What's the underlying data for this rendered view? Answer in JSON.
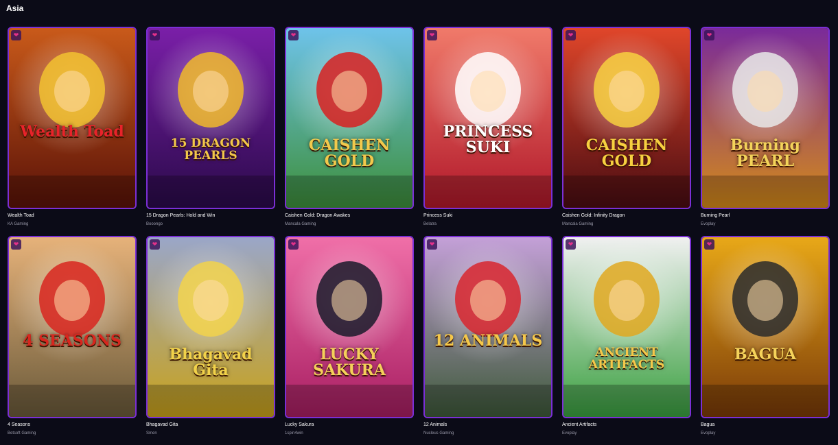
{
  "section": {
    "title": "Asia"
  },
  "games": [
    {
      "name": "Wealth Toad",
      "provider": "KA Gaming",
      "bg": [
        "#c95a1a",
        "#5a1208"
      ],
      "accent": "#f2c230",
      "logo": "Wealth Toad",
      "logo_color": "#e8232a",
      "fav_icon": "heart-icon"
    },
    {
      "name": "15 Dragon Pearls: Hold and Win",
      "provider": "Booongo",
      "bg": [
        "#7a1fa8",
        "#2a0a4a"
      ],
      "accent": "#f0b82a",
      "logo": "15 DRAGON PEARLS",
      "logo_color": "#f3c84a",
      "fav_icon": "heart-icon"
    },
    {
      "name": "Caishen Gold: Dragon Awakes",
      "provider": "Mancala Gaming",
      "bg": [
        "#6ec3ea",
        "#3d8f3a"
      ],
      "accent": "#d82020",
      "logo": "CAISHEN GOLD",
      "logo_color": "#f2c94c",
      "fav_icon": "heart-icon"
    },
    {
      "name": "Princess Suki",
      "provider": "Belatra",
      "bg": [
        "#f07a6a",
        "#b1182a"
      ],
      "accent": "#ffffff",
      "logo": "PRINCESS SUKI",
      "logo_color": "#ffffff",
      "fav_icon": "heart-icon"
    },
    {
      "name": "Caishen Gold: Infinity Dragon",
      "provider": "Mancala Gaming",
      "bg": [
        "#e0462a",
        "#4a0c12"
      ],
      "accent": "#f7d040",
      "logo": "CAISHEN GOLD",
      "logo_color": "#f7d040",
      "fav_icon": "heart-icon"
    },
    {
      "name": "Burning Pearl",
      "provider": "Evoplay",
      "bg": [
        "#7a2a9a",
        "#d48a18"
      ],
      "accent": "#e8e8e8",
      "logo": "Burning PEARL",
      "logo_color": "#f3d35a",
      "fav_icon": "heart-icon"
    },
    {
      "name": "4 Seasons",
      "provider": "Betsoft Gaming",
      "bg": [
        "#e6b27a",
        "#6a5a3a"
      ],
      "accent": "#d8261e",
      "logo": "4 SEASONS",
      "logo_color": "#d8261e",
      "fav_icon": "heart-icon"
    },
    {
      "name": "Bhagavad Gita",
      "provider": "Smen",
      "bg": [
        "#9aa6c8",
        "#c9a21a"
      ],
      "accent": "#f2d24a",
      "logo": "Bhagavad Gita",
      "logo_color": "#f2d24a",
      "fav_icon": "heart-icon"
    },
    {
      "name": "Lucky Sakura",
      "provider": "1spin4win",
      "bg": [
        "#f06fa8",
        "#a81e62"
      ],
      "accent": "#1a1a2a",
      "logo": "LUCKY SAKURA",
      "logo_color": "#f5d05a",
      "fav_icon": "heart-icon"
    },
    {
      "name": "12 Animals",
      "provider": "Nucleus Gaming",
      "bg": [
        "#c4a0d8",
        "#3e5a3a"
      ],
      "accent": "#d8262e",
      "logo": "12 ANIMALS",
      "logo_color": "#f5c84a",
      "fav_icon": "heart-icon"
    },
    {
      "name": "Ancient Artifacts",
      "provider": "Evoplay",
      "bg": [
        "#f0f0f0",
        "#3aa040"
      ],
      "accent": "#e0a820",
      "logo": "ANCIENT ARTIFACTS",
      "logo_color": "#f5c84a",
      "fav_icon": "heart-icon"
    },
    {
      "name": "Bagua",
      "provider": "Evoplay",
      "bg": [
        "#e8a818",
        "#7a3a08"
      ],
      "accent": "#2a2a2a",
      "logo": "BAGUA",
      "logo_color": "#f5d35a",
      "fav_icon": "heart-icon"
    }
  ]
}
